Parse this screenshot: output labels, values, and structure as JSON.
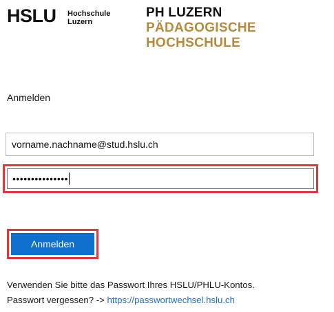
{
  "logos": {
    "hslu_wordmark": "HSLU",
    "hslu_sub_line1": "Hochschule",
    "hslu_sub_line2": "Luzern",
    "ph_line1": "PH LUZERN",
    "ph_line2": "PÄDAGOGISCHE",
    "ph_line3": "HOCHSCHULE"
  },
  "form": {
    "heading": "Anmelden",
    "email_value": "vorname.nachname@stud.hslu.ch",
    "password_mask": "•••••••••••••••",
    "submit_label": "Anmelden"
  },
  "info": {
    "line1": "Verwenden Sie bitte das Passwort Ihres HSLU/PHLU-Kontos.",
    "line2_prefix": "Passwort vergessen? ->",
    "link_text": "https://passwortwechsel.hslu.ch"
  },
  "colors": {
    "ph_gold": "#b58a3c",
    "highlight_red": "#e0383e",
    "button_blue": "#0f6fcf",
    "link_blue": "#1f6fc5"
  }
}
